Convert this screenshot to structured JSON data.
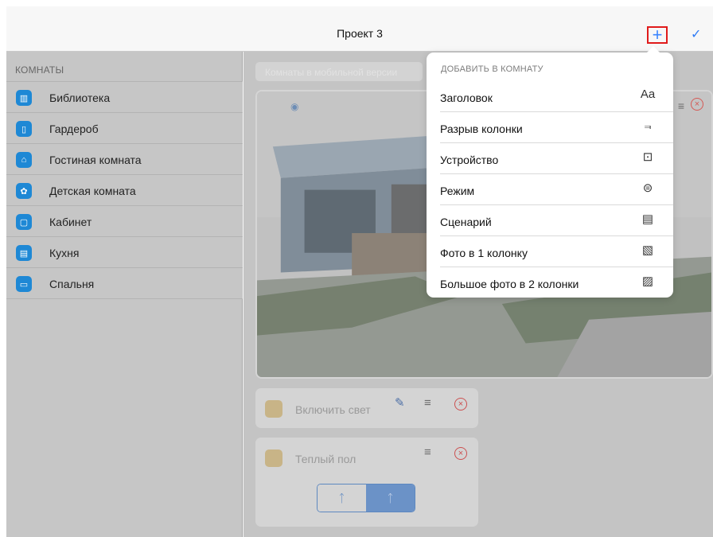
{
  "header": {
    "title": "Проект 3",
    "add_icon": "plus-icon",
    "done_icon": "checkmark-icon"
  },
  "sidebar": {
    "section_title": "КОМНАТЫ",
    "items": [
      {
        "label": "Библиотека",
        "icon": "library-icon"
      },
      {
        "label": "Гардероб",
        "icon": "wardrobe-icon"
      },
      {
        "label": "Гостиная комната",
        "icon": "sofa-icon"
      },
      {
        "label": "Детская комната",
        "icon": "kids-room-icon"
      },
      {
        "label": "Кабинет",
        "icon": "office-icon"
      },
      {
        "label": "Кухня",
        "icon": "kitchen-icon"
      },
      {
        "label": "Спальня",
        "icon": "bed-icon"
      }
    ]
  },
  "main": {
    "search_placeholder": "Комнаты в мобильной версии",
    "devices": [
      {
        "label": "Включить свет"
      },
      {
        "label": "Теплый пол"
      }
    ]
  },
  "popover": {
    "title": "ДОБАВИТЬ В КОМНАТУ",
    "items": [
      {
        "label": "Заголовок",
        "icon": "text-size-icon"
      },
      {
        "label": "Разрыв колонки",
        "icon": "column-break-icon"
      },
      {
        "label": "Устройство",
        "icon": "chip-icon"
      },
      {
        "label": "Режим",
        "icon": "toggle-icon"
      },
      {
        "label": "Сценарий",
        "icon": "script-icon"
      },
      {
        "label": "Фото в 1 колонку",
        "icon": "photo-icon"
      },
      {
        "label": "Большое фото в 2 колонки",
        "icon": "photo-x2-icon"
      }
    ]
  },
  "colors": {
    "accent": "#2f7cf6",
    "highlight": "#e01b1b",
    "room_icon": "#1e88d5",
    "delete": "#cc5050"
  }
}
